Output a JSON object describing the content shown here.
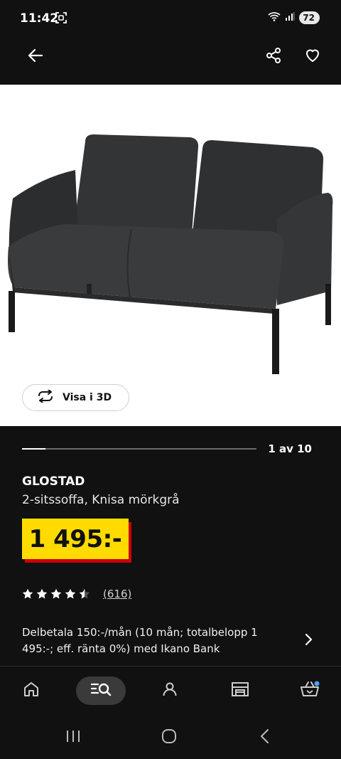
{
  "status_bar": {
    "time": "11:42",
    "battery": "72"
  },
  "app_bar": {
    "back_icon": "arrow-left-icon",
    "share_icon": "share-icon",
    "favorite_icon": "heart-icon"
  },
  "gallery": {
    "view_3d_label": "Visa i 3D",
    "position_label": "1 av 10",
    "current": 1,
    "total": 10
  },
  "product": {
    "name": "GLOSTAD",
    "description": "2-sitssoffa, Knisa mörkgrå",
    "price": "1 495:-",
    "rating_value": 4.5,
    "rating_count": "(616)",
    "installment_text": "Delbetala 150:-/mån (10 mån; totalbelopp 1 495:-; eff. ränta 0%) med Ikano Bank"
  },
  "bottom_nav": {
    "items": [
      "home-icon",
      "search-menu-icon",
      "profile-icon",
      "store-icon",
      "basket-icon"
    ],
    "active": "search-menu-icon"
  },
  "colors": {
    "background": "#111111",
    "price_yellow": "#ffdb00",
    "price_red": "#cc0008",
    "basket_dot": "#4aa3ff"
  }
}
